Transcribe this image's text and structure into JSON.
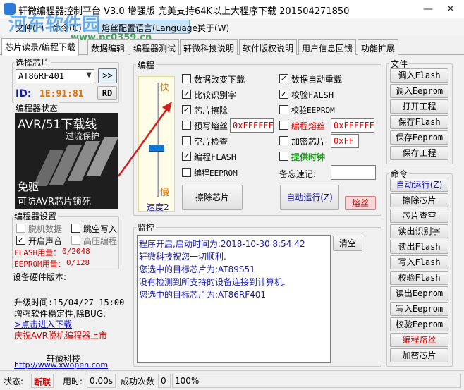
{
  "app": {
    "title": "轩微编程器控制平台 V3.0 增强版 完美支持64K以上大程序下载 201504271850",
    "window_controls": {
      "minimize": "—",
      "close": "✕"
    }
  },
  "menu": {
    "items": [
      "文件(F)",
      "命令(C)",
      "熔丝配置语言(Language)",
      "关于(W)"
    ]
  },
  "watermark": {
    "main": "河东软件园",
    "sub": "www.pc0359.cn"
  },
  "tabs": [
    "芯片读录/编程下载",
    "数据编辑",
    "编程器测试",
    "轩微科技说明",
    "软件版权说明",
    "用户信息回馈",
    "功能扩展"
  ],
  "chip_select": {
    "group_label": "选择芯片",
    "selected_chip": "AT86RF401",
    "next_button": ">>",
    "id_label": "ID:",
    "id_value": "1E:91:81",
    "read_id_button": "RD"
  },
  "programmer_status": {
    "group_label": "编程器状态",
    "image_text_top": "AVR/51下载线",
    "image_text_top2": "过流保护",
    "image_text_mid": "免驱",
    "image_text_bottom": "可防AVR芯片锁死"
  },
  "programmer_settings": {
    "group_label": "编程器设置",
    "options": [
      {
        "label": "脱机数据",
        "checked": false,
        "enabled": false
      },
      {
        "label": "跳空写入",
        "checked": false,
        "enabled": true
      },
      {
        "label": "开启声音",
        "checked": true,
        "enabled": true
      },
      {
        "label": "高压编程",
        "checked": false,
        "enabled": false
      }
    ],
    "flash_usage_label": "FLASH用量：",
    "flash_usage_value": "0/2048",
    "eeprom_usage_label": "EEPROM用量：",
    "eeprom_usage_value": "0/128"
  },
  "hardware": {
    "version_label": "设备硬件版本:",
    "upgrade_time": "升级时间:15/04/27 15:00",
    "upgrade_note": "增强软件稳定性,除BUG.",
    "download_link": ">点击进入下载",
    "celebrate": "庆祝AVR脱机编程器上市",
    "company": "轩微科技",
    "url": "http://www.xwopen.com"
  },
  "programming": {
    "group_label": "编程",
    "speed_fast": "快",
    "speed_slow": "慢",
    "speed_label": "速度2",
    "speed_level": 2,
    "options_left": [
      {
        "label": "数据改变下载",
        "checked": false
      },
      {
        "label": "比较识别字",
        "checked": true
      },
      {
        "label": "芯片擦除",
        "checked": true
      },
      {
        "label": "预写熔丝",
        "checked": false
      },
      {
        "label": "空片检查",
        "checked": false
      },
      {
        "label": "编程FLASH",
        "checked": true
      },
      {
        "label": "编程EEPROM",
        "checked": false
      }
    ],
    "options_right": [
      {
        "label": "数据自动重载",
        "checked": true
      },
      {
        "label": "校验FALSH",
        "checked": true
      },
      {
        "label": "校验EEPROM",
        "checked": false
      },
      {
        "label": "编程熔丝",
        "checked": false
      },
      {
        "label": "加密芯片",
        "checked": false
      },
      {
        "label": "提供时钟",
        "checked": false
      }
    ],
    "prefuse_value": "0xFFFFFF",
    "fuse_value": "0xFFFFFF",
    "lock_value": "0xFF",
    "memo_label": "备忘速记:",
    "memo_value": "",
    "erase_button": "擦除芯片",
    "auto_run_button": "自动运行(Z)",
    "fuse_button": "熔丝"
  },
  "monitor": {
    "group_label": "监控",
    "clear_button": "清空",
    "lines": [
      "程序开启,启动时间为:2018-10-30 8:54:42",
      "轩微科技祝您一切顺利.",
      "您选中的目标芯片为:AT89S51",
      "没有检测到所支持的设备连接到计算机.",
      "您选中的目标芯片为:AT86RF401"
    ]
  },
  "file_panel": {
    "group_label": "文件",
    "buttons": [
      "调入Flash",
      "调入Eeprom",
      "打开工程",
      "保存Flash",
      "保存Eeprom",
      "保存工程"
    ]
  },
  "command_panel": {
    "group_label": "命令",
    "buttons": [
      "自动运行(Z)",
      "擦除芯片",
      "芯片查空",
      "读出识别字",
      "读出Flash",
      "写入Flash",
      "校验Flash",
      "读出Eeprom",
      "写入Eeprom",
      "校验Eeprom",
      "编程熔丝",
      "加密芯片"
    ]
  },
  "statusbar": {
    "status_label": "状态:",
    "status_value": "断联",
    "time_label": "用时:",
    "time_value": "0.00s",
    "success_label": "成功次数",
    "success_value": "0",
    "percent_value": "100%"
  },
  "colors": {
    "accent_blue": "#1a1aa8",
    "warning_red": "#d00000",
    "id_orange": "#e07000",
    "selection": "#cce4f7"
  }
}
